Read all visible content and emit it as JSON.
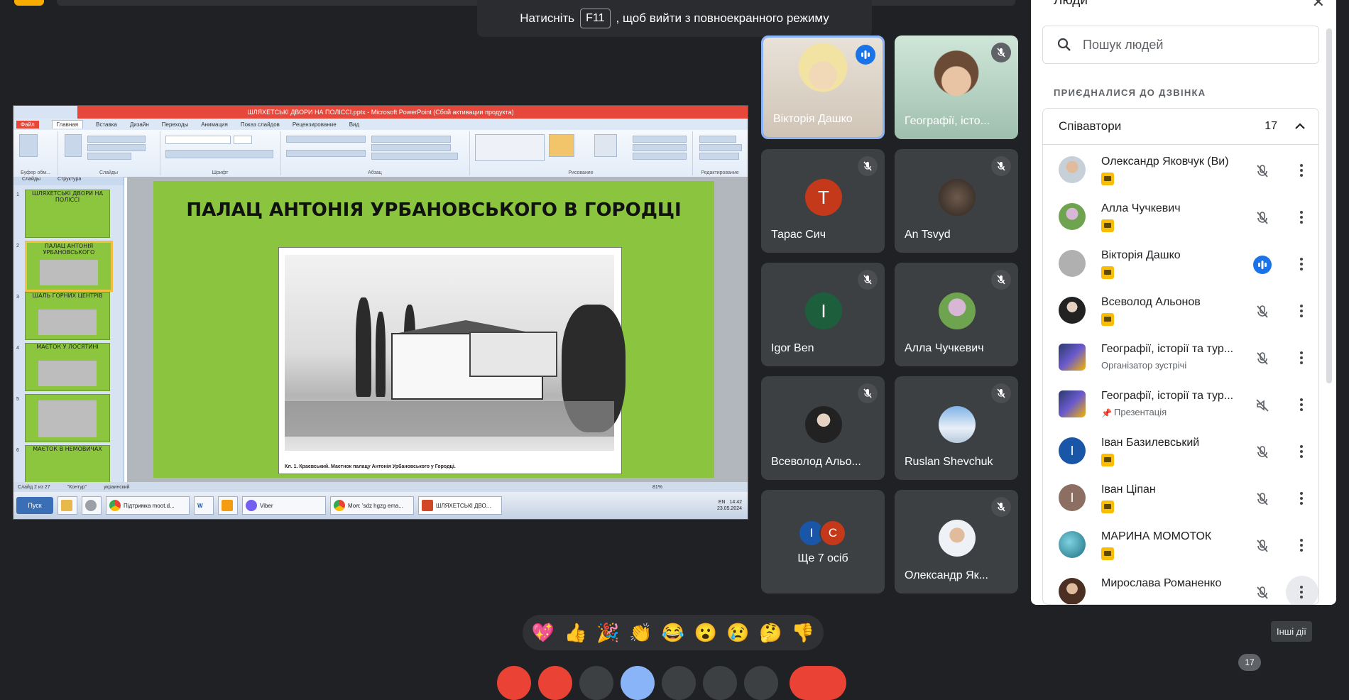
{
  "banner": {
    "before": "Натисніть",
    "key": "F11",
    "after": ", щоб вийти з повноекранного режиму"
  },
  "presentation": {
    "title_bar": "ШЛЯХЕТСЬКІ ДВОРИ НА ПОЛІССІ.pptx - Microsoft PowerPoint (Сбой активации продукта)",
    "tabs": [
      "Файл",
      "Главная",
      "Вставка",
      "Дизайн",
      "Переходы",
      "Анимация",
      "Показ слайдов",
      "Рецензирование",
      "Вид"
    ],
    "ribbon_groups": [
      "Буфер обм...",
      "Слайды",
      "Шрифт",
      "Абзац",
      "Рисование",
      "Редактирование"
    ],
    "left_tabs": [
      "Слайды",
      "Структура"
    ],
    "thumbnails": [
      {
        "num": "1",
        "text": "ШЛЯХЕТСЬКІ ДВОРИ НА ПОЛІССІ"
      },
      {
        "num": "2",
        "text": "ПАЛАЦ АНТОНІЯ УРБАНОВСЬКОГО"
      },
      {
        "num": "3",
        "text": "ШАЛЬ ГОРНИХ ЦЕНТРІВ"
      },
      {
        "num": "4",
        "text": "МАЄТОК У ЛОСЯТИНІ"
      },
      {
        "num": "5",
        "text": ""
      },
      {
        "num": "6",
        "text": "МАЄТОК В НЕМОВИЧАХ"
      }
    ],
    "slide_title": "ПАЛАЦ АНТОНІЯ УРБАНОВСЬКОГО В ГОРОДЦІ",
    "caption": "Кл. 1. Краєвський. Маєтнок палацу Антонія Урбановського у Городці.",
    "status": [
      "Слайд 2 из 27",
      "\"Контур\"",
      "украинский"
    ],
    "zoom": "81%",
    "taskbar": {
      "start": "Пуск",
      "items": [
        "Підтримка moot.d...",
        "W",
        "",
        "Viber",
        "Моя: 'sdz hgzg ema...",
        "ШЛЯХЕТСЬКІ ДВО..."
      ],
      "lang": "EN",
      "time": "14:42",
      "date": "23.05.2024"
    }
  },
  "tiles": [
    {
      "name": "Вікторія Дашко",
      "state": "speaking"
    },
    {
      "name": "Географії, істо...",
      "state": "muted"
    },
    {
      "name": "Тарас Сич",
      "initial": "Т",
      "color": "#c5391b",
      "state": "muted"
    },
    {
      "name": "An Tsvyd",
      "state": "muted"
    },
    {
      "name": "Igor Ben",
      "initial": "I",
      "color": "#1d5e3d",
      "state": "muted"
    },
    {
      "name": "Алла Чучкевич",
      "state": "muted"
    },
    {
      "name": "Всеволод Альо...",
      "state": "muted"
    },
    {
      "name": "Ruslan Shevchuk",
      "state": "muted"
    },
    {
      "name": "Ще 7 осіб",
      "initials": [
        "I",
        "С"
      ]
    },
    {
      "name": "Олександр Як...",
      "state": "muted"
    }
  ],
  "reactions": [
    "💖",
    "👍",
    "🎉",
    "👏",
    "😂",
    "😮",
    "😢",
    "🤔",
    "👎"
  ],
  "more_actions": "Інші дії",
  "participant_count": "17",
  "people": {
    "title": "Люди",
    "search_placeholder": "Пошук людей",
    "section": "ПРИЄДНАЛИСЯ ДО ДЗВІНКА",
    "group_title": "Співавтори",
    "group_count": "17",
    "list": [
      {
        "name": "Олександр Яковчук (Ви)",
        "sub": "",
        "mic": "muted"
      },
      {
        "name": "Алла Чучкевич",
        "sub": "",
        "mic": "muted"
      },
      {
        "name": "Вікторія Дашко",
        "sub": "",
        "mic": "speaking"
      },
      {
        "name": "Всеволод Альонов",
        "sub": "",
        "mic": "muted"
      },
      {
        "name": "Географії, історії та тур...",
        "sub": "Організатор зустрічі",
        "mic": "muted"
      },
      {
        "name": "Географії, історії та тур...",
        "sub": "Презентація",
        "mic": "present"
      },
      {
        "name": "Іван Базилевський",
        "sub": "",
        "mic": "muted",
        "initial": "І",
        "color": "#1a56a8"
      },
      {
        "name": "Іван Ціпан",
        "sub": "",
        "mic": "muted",
        "initial": "І",
        "color": "#8d6e63"
      },
      {
        "name": "МАРИНА МОМОТОК",
        "sub": "",
        "mic": "muted"
      },
      {
        "name": "Мирослава Романенко",
        "sub": "",
        "mic": "muted"
      }
    ]
  },
  "colors": {
    "bg": "#202124",
    "tile": "#3c4043",
    "accent": "#1a73e8",
    "badge": "#fbbc04",
    "slide_green": "#8bc43f"
  },
  "icons": [
    "search-icon",
    "close-icon",
    "chevron-up-icon",
    "mic-off-icon",
    "speaking-icon",
    "more-vert-icon",
    "present-icon"
  ]
}
